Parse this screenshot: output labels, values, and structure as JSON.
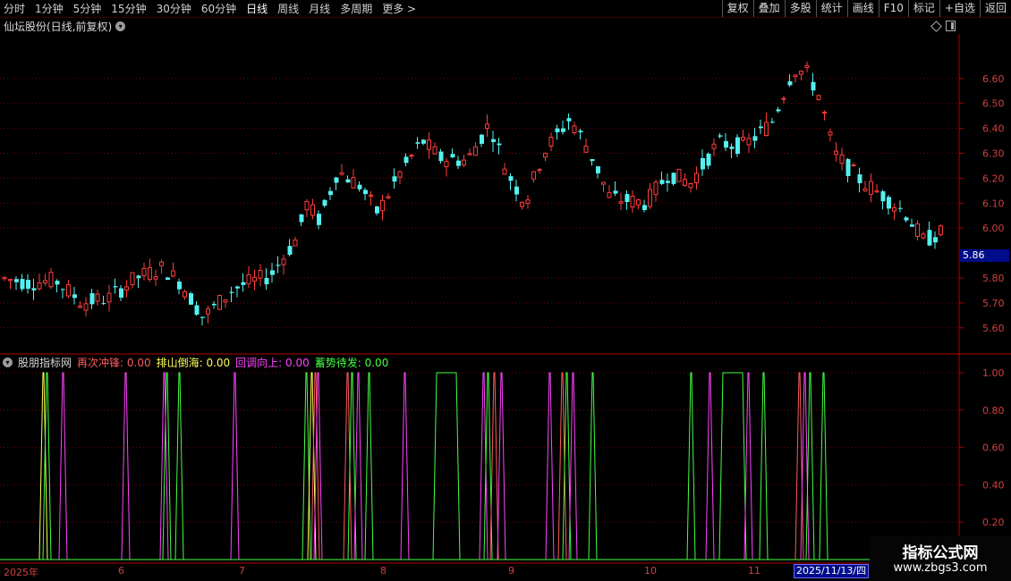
{
  "toolbar": {
    "periods": [
      "分时",
      "1分钟",
      "5分钟",
      "15分钟",
      "30分钟",
      "60分钟",
      "日线",
      "周线",
      "月线",
      "多周期",
      "更多"
    ],
    "active": "日线",
    "more_arrow": ">",
    "buttons": [
      "复权",
      "叠加",
      "多股",
      "统计",
      "画线",
      "F10",
      "标记",
      "+自选",
      "返回"
    ]
  },
  "main_chart": {
    "title": "仙坛股份(日线,前复权)",
    "price_axis": [
      "6.60",
      "6.50",
      "6.40",
      "6.30",
      "6.20",
      "6.10",
      "6.00",
      "5.80",
      "5.70",
      "5.60"
    ],
    "current_price": "5.86"
  },
  "indicator": {
    "name": "股朋指标网",
    "items": [
      {
        "label": "再次冲锋: 0.00",
        "color": "#ff5a5a"
      },
      {
        "label": "排山倒海: 0.00",
        "color": "#ffff55"
      },
      {
        "label": "回调向上: 0.00",
        "color": "#ff44ff"
      },
      {
        "label": "蓄势待发: 0.00",
        "color": "#44ff44"
      }
    ],
    "axis": [
      "1.00",
      "0.80",
      "0.60",
      "0.40",
      "0.20"
    ]
  },
  "time_axis": {
    "labels": [
      "2025年",
      "6",
      "7",
      "8",
      "9",
      "10",
      "11"
    ],
    "cursor_date": "2025/11/13/四"
  },
  "watermark": {
    "line1": "指标公式网",
    "line2": "www.zbgs3.com"
  },
  "colors": {
    "up": "#ff3c3c",
    "down": "#54f0f0",
    "grid": "#7a0000",
    "axis": "#b00000"
  }
}
